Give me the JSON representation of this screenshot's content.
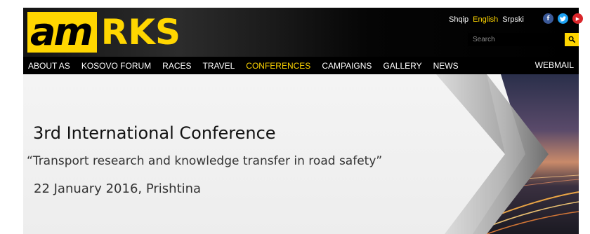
{
  "logo": {
    "am": "am",
    "rks": "RKS"
  },
  "languages": [
    {
      "label": "Shqip",
      "active": false
    },
    {
      "label": "English",
      "active": true
    },
    {
      "label": "Srpski",
      "active": false
    }
  ],
  "social": {
    "facebook": "f",
    "twitter": "t",
    "youtube": "▶"
  },
  "search": {
    "placeholder": "Search"
  },
  "nav": {
    "items": [
      "ABOUT AS",
      "KOSOVO FORUM",
      "RACES",
      "TRAVEL",
      "CONFERENCES",
      "CAMPAIGNS",
      "GALLERY",
      "NEWS"
    ],
    "active": "CONFERENCES",
    "webmail": "WEBMAIL"
  },
  "banner": {
    "title": "3rd International Conference",
    "subtitle": "“Transport research and knowledge transfer in road safety”",
    "date": "22 January 2016, Prishtina"
  },
  "colors": {
    "accent": "#ffd600",
    "header_bg": "#000000"
  }
}
